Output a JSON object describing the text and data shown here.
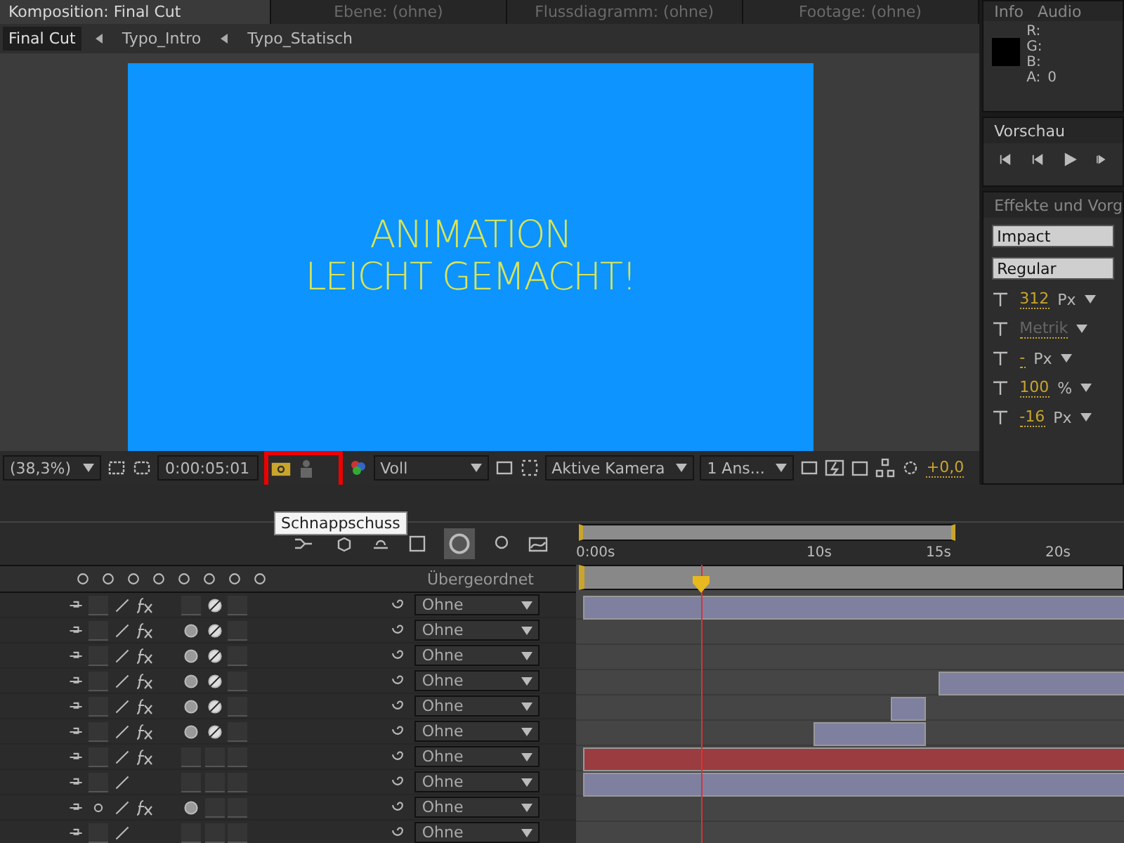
{
  "comp_tabs": [
    {
      "label": "Komposition: Final Cut",
      "selected": true
    },
    {
      "label": "Ebene: (ohne)",
      "selected": false
    },
    {
      "label": "Flussdiagramm: (ohne)",
      "selected": false
    },
    {
      "label": "Footage: (ohne)",
      "selected": false
    }
  ],
  "breadcrumbs": [
    {
      "label": "Final Cut",
      "selected": true
    },
    {
      "label": "Typo_Intro",
      "selected": false
    },
    {
      "label": "Typo_Statisch",
      "selected": false
    }
  ],
  "viewer": {
    "lines": [
      "ANIMATION",
      "LEICHT GEMACHT!"
    ]
  },
  "viewer_toolbar": {
    "zoom": "(38,3%)",
    "timecode": "0:00:05:01",
    "resolution": "Voll",
    "camera": "Aktive Kamera",
    "views": "1 Ans...",
    "exposure": "+0,0"
  },
  "tooltip": "Schnappschuss",
  "info_panel": {
    "tabs": [
      "Info",
      "Audio"
    ],
    "channels": [
      "R:",
      "G:",
      "B:",
      "A:"
    ],
    "alpha": "0"
  },
  "preview_panel": {
    "title": "Vorschau"
  },
  "effects_panel": {
    "title": "Effekte und Vorg"
  },
  "character": {
    "font": "Impact",
    "style": "Regular",
    "size": "312",
    "size_unit": "Px",
    "kerning": "Metrik",
    "leading": "-",
    "leading_unit": "Px",
    "scale": "100",
    "scale_unit": "%",
    "baseline": "-16",
    "baseline_unit": "Px"
  },
  "timeline": {
    "parent_header": "Übergeordnet",
    "ruler": [
      "0:00s",
      "10s",
      "15s",
      "20s"
    ],
    "layers": [
      {
        "collapse": false,
        "fx": true,
        "motion_blur": false,
        "adjustment": true,
        "parent": "Ohne",
        "color": "#7f7fa0"
      },
      {
        "collapse": false,
        "fx": true,
        "motion_blur": true,
        "adjustment": true,
        "parent": "Ohne"
      },
      {
        "collapse": false,
        "fx": true,
        "motion_blur": true,
        "adjustment": true,
        "parent": "Ohne"
      },
      {
        "collapse": false,
        "fx": true,
        "motion_blur": true,
        "adjustment": true,
        "parent": "Ohne",
        "color": "#7f7fa0"
      },
      {
        "collapse": false,
        "fx": true,
        "motion_blur": true,
        "adjustment": true,
        "parent": "Ohne",
        "color": "#7f7fa0"
      },
      {
        "collapse": false,
        "fx": true,
        "motion_blur": true,
        "adjustment": true,
        "parent": "Ohne",
        "color": "#7f7fa0"
      },
      {
        "collapse": false,
        "fx": true,
        "motion_blur": false,
        "adjustment": false,
        "parent": "Ohne",
        "color": "#9a3c40"
      },
      {
        "collapse": false,
        "fx": false,
        "motion_blur": false,
        "adjustment": false,
        "parent": "Ohne",
        "color": "#7f7fa0"
      },
      {
        "collapse": true,
        "fx": true,
        "motion_blur": true,
        "adjustment": false,
        "parent": "Ohne"
      },
      {
        "collapse": false,
        "fx": false,
        "motion_blur": false,
        "adjustment": false,
        "parent": "Ohne"
      }
    ]
  }
}
